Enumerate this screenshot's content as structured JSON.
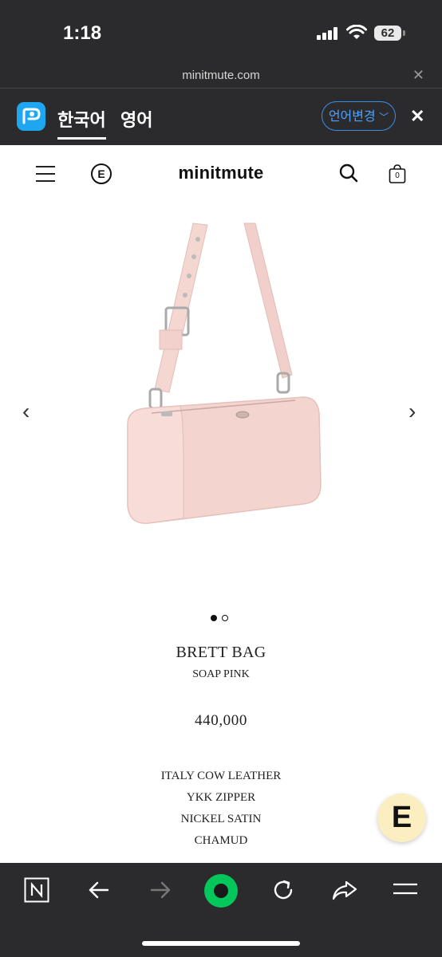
{
  "status_bar": {
    "time": "1:18",
    "battery": "62"
  },
  "url_bar": {
    "url": "minitmute.com"
  },
  "translate_bar": {
    "lang_source": "한국어",
    "lang_target": "영어",
    "change_label": "언어변경"
  },
  "site_header": {
    "brand": "minitmute",
    "cart_count": "0"
  },
  "product": {
    "name": "BRETT BAG",
    "color": "SOAP PINK",
    "price": "440,000",
    "details": [
      "ITALY COW LEATHER",
      "YKK ZIPPER",
      "NICKEL SATIN",
      "CHAMUD"
    ],
    "image_count": 2,
    "active_image": 1,
    "bag_color": "#f4d4cf"
  },
  "colors": {
    "chrome": "#2b2b2d",
    "accent_blue": "#4aa1ff",
    "fab_bg": "#fbeec0",
    "naver_green": "#03c75a"
  }
}
